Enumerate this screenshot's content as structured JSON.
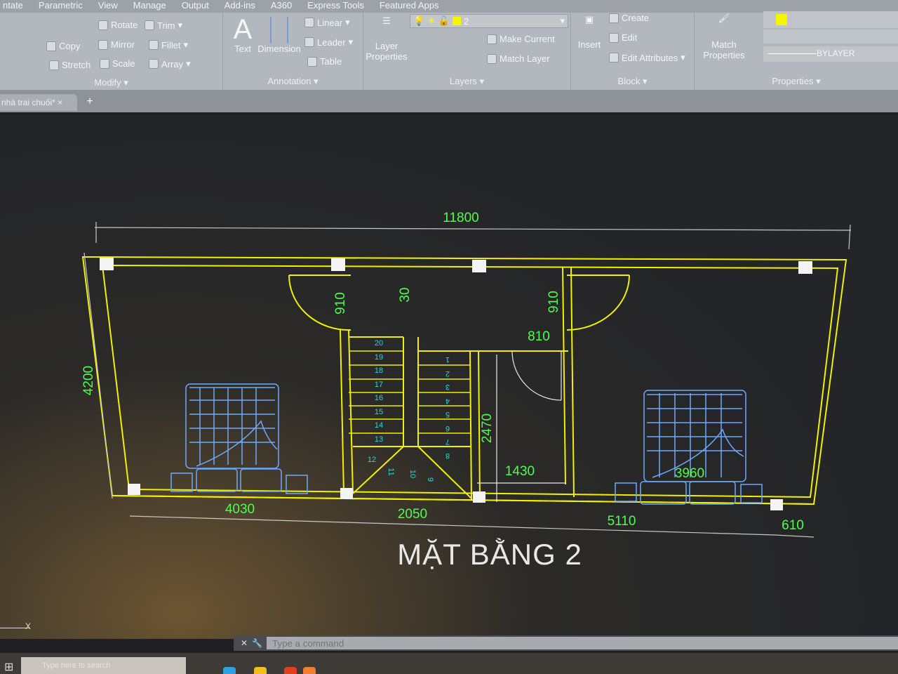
{
  "ribbon_tabs": [
    "ntate",
    "Parametric",
    "View",
    "Manage",
    "Output",
    "Add-ins",
    "A360",
    "Express Tools",
    "Featured Apps"
  ],
  "modify": {
    "title": "Modify",
    "rotate": "Rotate",
    "trim": "Trim",
    "copy": "Copy",
    "mirror": "Mirror",
    "fillet": "Fillet",
    "stretch": "Stretch",
    "scale": "Scale",
    "array": "Array"
  },
  "annotation": {
    "title": "Annotation",
    "text": "Text",
    "dimension": "Dimension",
    "linear": "Linear",
    "leader": "Leader",
    "table": "Table"
  },
  "layers": {
    "title": "Layers",
    "layer_properties": "Layer Properties",
    "current_layer": "2",
    "make_current": "Make Current",
    "match_layer": "Match Layer",
    "layer_color": "#f5f500"
  },
  "block": {
    "title": "Block",
    "insert": "Insert",
    "create": "Create",
    "edit": "Edit",
    "edit_attributes": "Edit Attributes"
  },
  "properties": {
    "title": "Properties",
    "match_properties": "Match Properties",
    "lineweight": "BYLAYER",
    "color": "#f5f500"
  },
  "document_tab": "nhà trai chuối*",
  "drawing": {
    "title": "MẶT BẰNG 2",
    "dimensions": {
      "overall_width": "11800",
      "overall_depth": "4200",
      "door_left": "910",
      "door_stair": "30",
      "door_right": "910",
      "bath_door": "810",
      "bath_depth": "2470",
      "bath_width": "1430",
      "bed_right": "3960",
      "room_left": "4030",
      "stair": "2050",
      "room_right": "5110",
      "balcony": "610"
    },
    "stair_left": [
      "20",
      "19",
      "18",
      "17",
      "16",
      "15",
      "14",
      "13"
    ],
    "stair_right": [
      "1",
      "2",
      "3",
      "4",
      "5",
      "6",
      "7",
      "8"
    ],
    "stair_landing": [
      "12",
      "11",
      "10",
      "9"
    ],
    "wall_color": "#f0f000",
    "dimension_color": "#4dff4d",
    "stair_label_color": "#22d8e8"
  },
  "command_line": {
    "placeholder": "Type a command"
  },
  "taskbar": {
    "search_placeholder": "Type here to search"
  }
}
